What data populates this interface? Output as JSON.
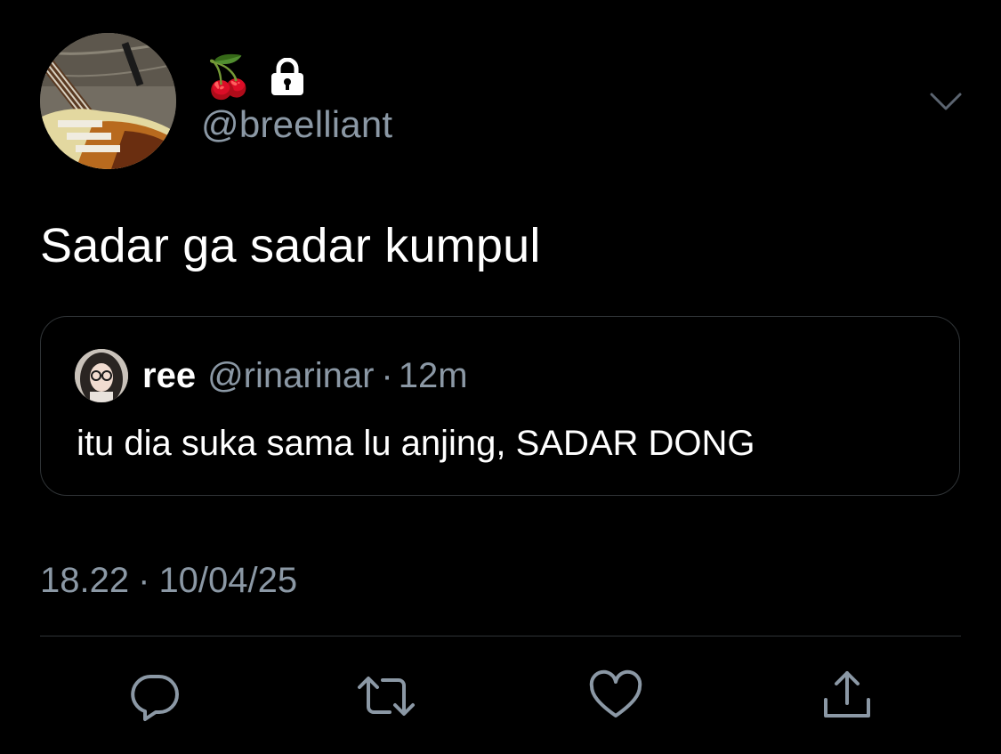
{
  "author": {
    "display_name_emojis": [
      "🍒"
    ],
    "protected_icon": "lock-icon",
    "handle": "@breelliant",
    "avatar_icon": "guitar-photo-avatar"
  },
  "tweet": {
    "text": "Sadar ga sadar kumpul",
    "time": "18.22",
    "separator": "·",
    "date": "10/04/25"
  },
  "quote": {
    "name": "ree",
    "handle": "@rinarinar",
    "separator": "·",
    "time": "12m",
    "text": "itu dia suka sama lu anjing, SADAR DONG",
    "avatar_icon": "person-photo-avatar"
  },
  "actions": {
    "reply_icon": "reply-icon",
    "retweet_icon": "retweet-icon",
    "like_icon": "heart-icon",
    "share_icon": "share-icon"
  },
  "colors": {
    "background": "#000000",
    "primary_text": "#ffffff",
    "secondary_text": "#8b98a5",
    "border": "#2f3336"
  }
}
